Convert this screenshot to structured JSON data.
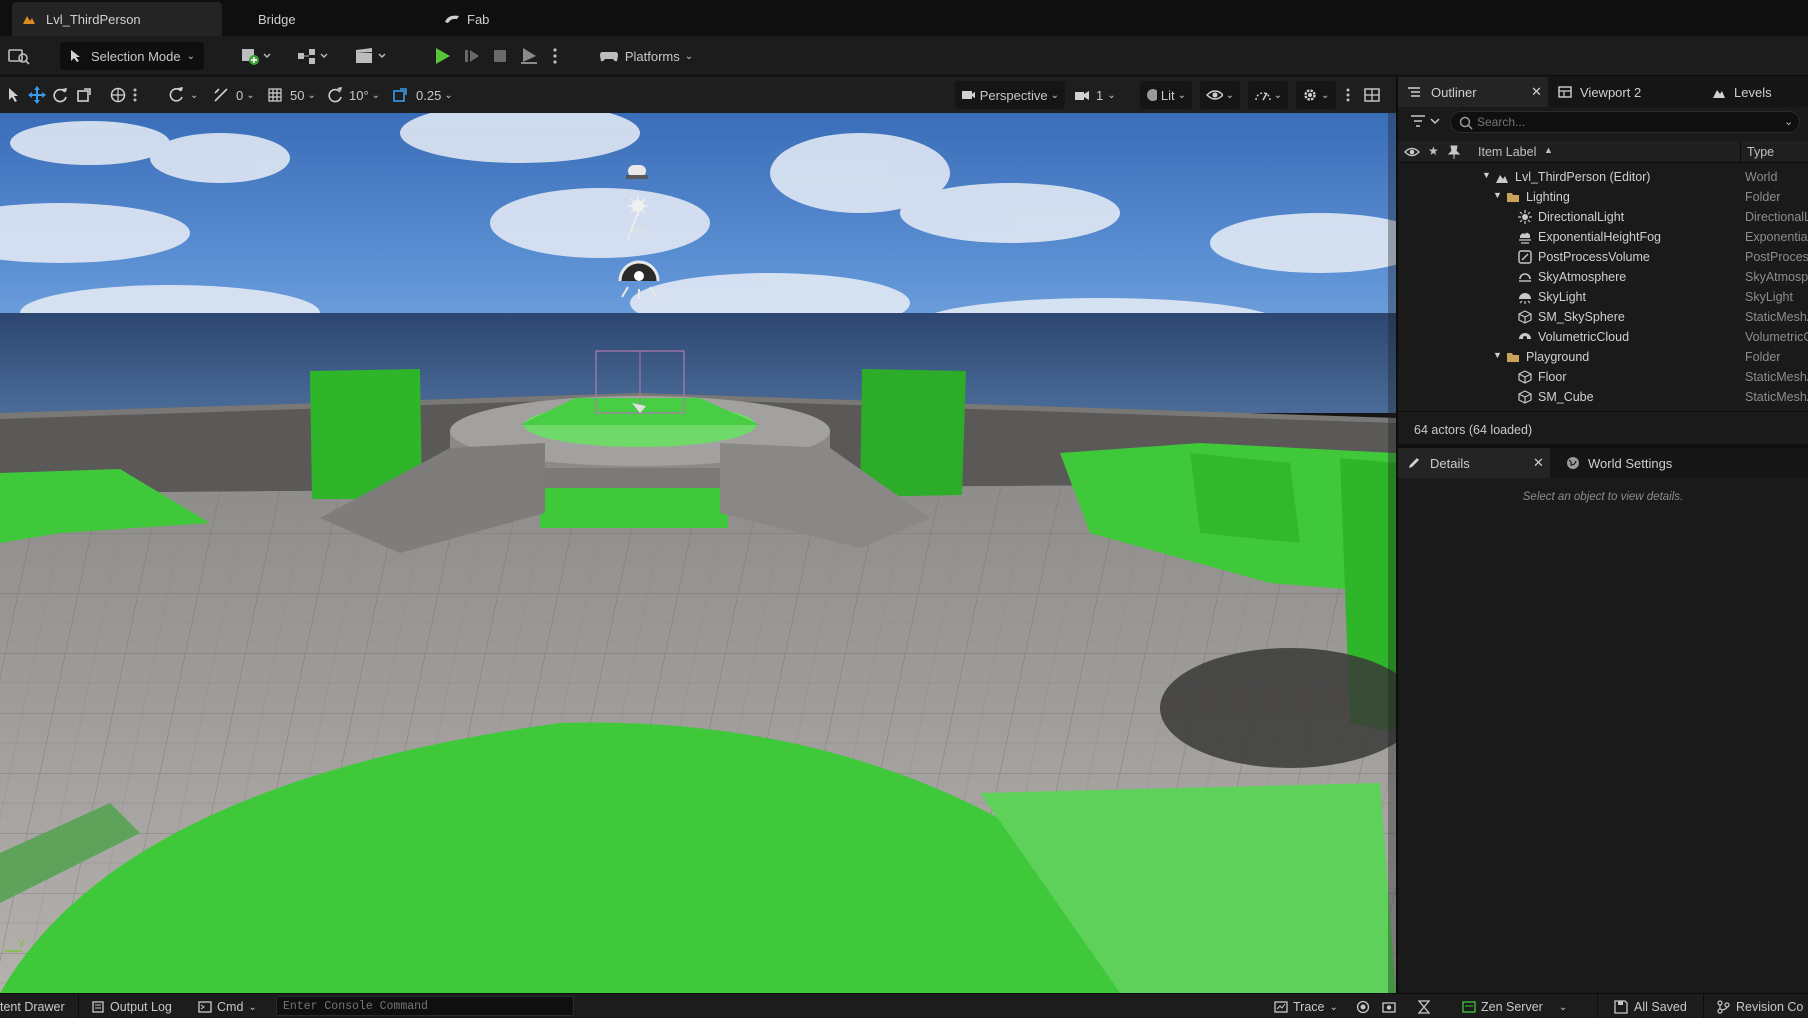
{
  "tabs": [
    {
      "label": "Lvl_ThirdPerson",
      "active": true,
      "icon": "level-icon"
    },
    {
      "label": "Bridge",
      "active": false
    },
    {
      "label": "Fab",
      "active": false,
      "icon": "fab-icon"
    }
  ],
  "main_toolbar": {
    "selection_mode": "Selection Mode",
    "platforms": "Platforms"
  },
  "viewport_toolbar": {
    "rotation_snap_small": "0",
    "grid_snap": "50",
    "rotation_snap": "10°",
    "scale_snap": "0.25",
    "view_mode": "Perspective",
    "camera_speed": "1",
    "lighting_mode": "Lit"
  },
  "outliner": {
    "tab_label": "Outliner",
    "viewport2_label": "Viewport 2",
    "levels_label": "Levels",
    "search_placeholder": "Search...",
    "col_item_label": "Item Label",
    "col_type": "Type",
    "rows": [
      {
        "label": "Lvl_ThirdPerson (Editor)",
        "type": "World"
      },
      {
        "label": "Lighting",
        "type": "Folder"
      },
      {
        "label": "DirectionalLight",
        "type": "DirectionalLight"
      },
      {
        "label": "ExponentialHeightFog",
        "type": "ExponentialHeightFog"
      },
      {
        "label": "PostProcessVolume",
        "type": "PostProcessVolume"
      },
      {
        "label": "SkyAtmosphere",
        "type": "SkyAtmosphere"
      },
      {
        "label": "SkyLight",
        "type": "SkyLight"
      },
      {
        "label": "SM_SkySphere",
        "type": "StaticMeshActor"
      },
      {
        "label": "VolumetricCloud",
        "type": "VolumetricCloud"
      },
      {
        "label": "Playground",
        "type": "Folder"
      },
      {
        "label": "Floor",
        "type": "StaticMeshActor"
      },
      {
        "label": "SM_Cube",
        "type": "StaticMeshActor"
      }
    ],
    "actor_count": "64 actors (64 loaded)"
  },
  "details": {
    "tab_label": "Details",
    "world_settings_label": "World Settings",
    "empty_message": "Select an object to view details."
  },
  "statusbar": {
    "content_drawer": "tent Drawer",
    "output_log": "Output Log",
    "cmd": "Cmd",
    "console_placeholder": "Enter Console Command",
    "trace": "Trace",
    "zen_server": "Zen Server",
    "all_saved": "All Saved",
    "revision_control": "Revision Co"
  },
  "colors": {
    "accent_green": "#3fc83a",
    "play_green": "#55c43a",
    "panel_bg": "#1a1a1a",
    "selected_tab": "#242424"
  }
}
